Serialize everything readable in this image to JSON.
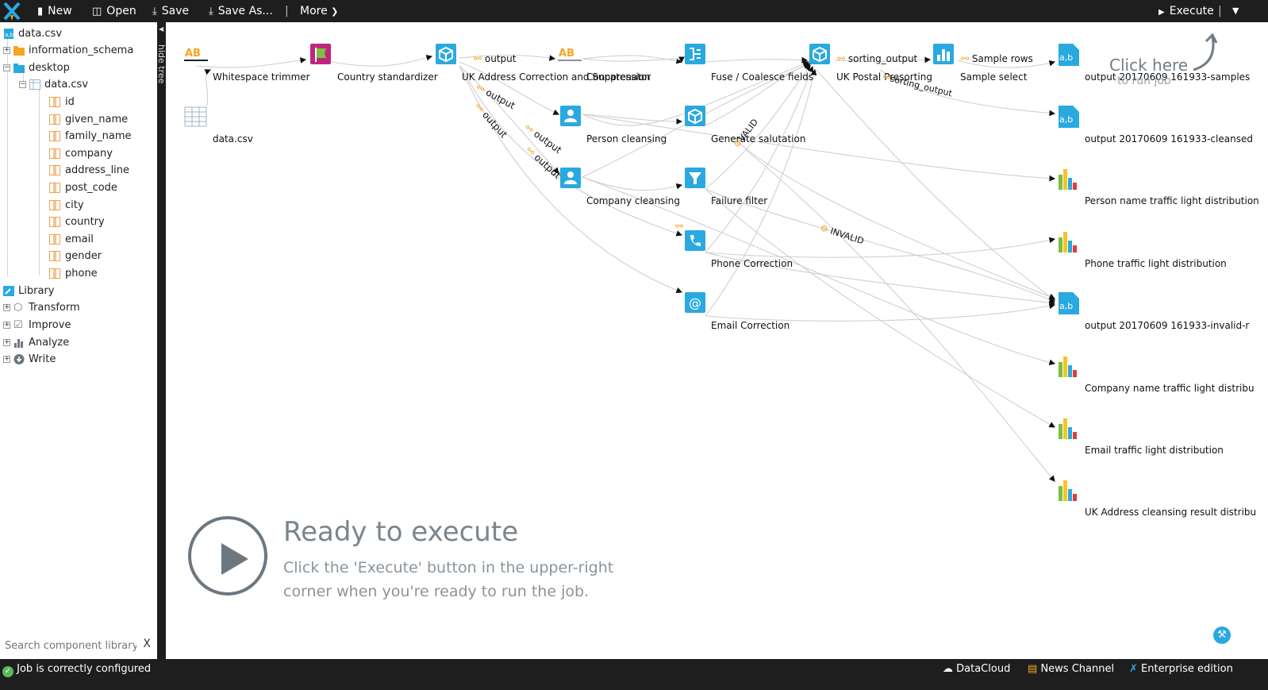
{
  "toolbar": {
    "new_label": "New",
    "open_label": "Open",
    "save_label": "Save",
    "save_as_label": "Save As...",
    "separator": "|",
    "more_label": "More",
    "execute_label": "Execute",
    "execute_separator": "|"
  },
  "tree": {
    "root": "data.csv",
    "information_schema": "information_schema",
    "desktop": "desktop",
    "table": "data.csv",
    "columns": [
      "id",
      "given_name",
      "family_name",
      "company",
      "address_line",
      "post_code",
      "city",
      "country",
      "email",
      "gender",
      "phone"
    ],
    "library": "Library",
    "library_items": [
      "Transform",
      "Improve",
      "Analyze",
      "Write"
    ]
  },
  "search": {
    "placeholder": "Search component library...",
    "clear": "X"
  },
  "splitter": {
    "label": "hide tree"
  },
  "canvas": {
    "nodes": {
      "whitespace": "Whitespace trimmer",
      "datacsv": "data.csv",
      "country": "Country standardizer",
      "uk_address": "UK Address Correction and Suppression",
      "concatenator": "Concatenator",
      "person": "Person cleansing",
      "company": "Company cleansing",
      "fuse": "Fuse / Coalesce fields",
      "salutation": "Generate salutation",
      "failure": "Failure filter",
      "phone": "Phone Correction",
      "email": "Email Correction",
      "postal": "UK Postal Presorting",
      "sample": "Sample select",
      "out_samples": "output 20170609 161933-samples",
      "out_cleansed": "output 20170609 161933-cleansed",
      "person_tl": "Person name traffic light distribution",
      "phone_tl": "Phone traffic light distribution",
      "out_invalid": "output 20170609 161933-invalid-r",
      "company_tl": "Company name traffic light distribu",
      "email_tl": "Email traffic light distribution",
      "uk_result": "UK Address cleansing result distribu"
    },
    "links": {
      "output": "output",
      "sorting_output_1": "sorting_output",
      "sample_rows": "Sample rows",
      "sorting_output_2": "sorting_output",
      "valid": "VALID",
      "invalid": "INVALID"
    }
  },
  "ready": {
    "title": "Ready to execute",
    "message": "Click the 'Execute' button in the upper-right corner when you're ready to run the job."
  },
  "hint": {
    "line1": "Click here",
    "line2": "to run job"
  },
  "status": {
    "job": "Job is correctly configured",
    "datacloud": "DataCloud",
    "news": "News Channel",
    "edition": "Enterprise edition"
  },
  "colors": {
    "accent": "#29a9e0",
    "toolbar_bg": "#1e1e1e",
    "link_orange": "#f5a623",
    "ok_green": "#5cb85c"
  }
}
